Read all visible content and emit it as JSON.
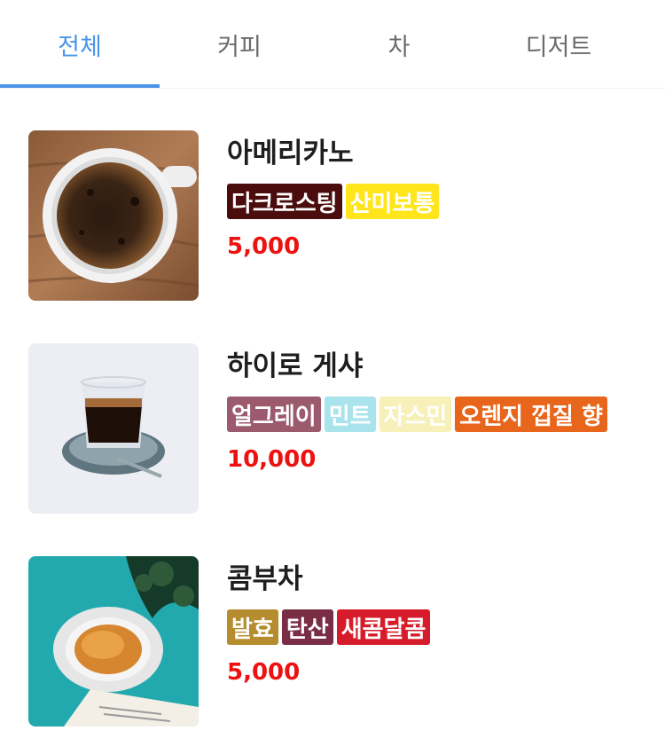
{
  "tabs": [
    {
      "label": "전체",
      "active": true
    },
    {
      "label": "커피",
      "active": false
    },
    {
      "label": "차",
      "active": false
    },
    {
      "label": "디저트",
      "active": false
    }
  ],
  "colors": {
    "accent": "#4a95ea",
    "price": "#ee1111"
  },
  "items": [
    {
      "name": "아메리카노",
      "image": "coffee-cup-photo",
      "tags": [
        {
          "label": "다크로스팅",
          "bg": "#4a0c0c"
        },
        {
          "label": "산미보통",
          "bg": "#ffe51a"
        }
      ],
      "price": "5,000"
    },
    {
      "name": "하이로 게샤",
      "image": "espresso-glass-photo",
      "tags": [
        {
          "label": "얼그레이",
          "bg": "#9b5a6e"
        },
        {
          "label": "민트",
          "bg": "#a9e3ec"
        },
        {
          "label": "자스민",
          "bg": "#f7f0b8"
        },
        {
          "label": "오렌지 껍질 향",
          "bg": "#e8661c"
        }
      ],
      "price": "10,000"
    },
    {
      "name": "콤부차",
      "image": "tea-cup-photo",
      "tags": [
        {
          "label": "발효",
          "bg": "#b58d2e"
        },
        {
          "label": "탄산",
          "bg": "#7a2e45"
        },
        {
          "label": "새콤달콤",
          "bg": "#d61c2a"
        }
      ],
      "price": "5,000"
    }
  ]
}
